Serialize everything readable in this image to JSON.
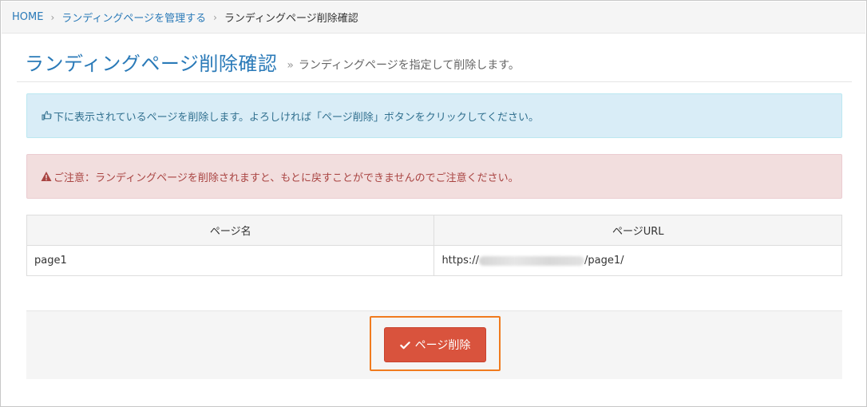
{
  "breadcrumb": {
    "home": "HOME",
    "parent": "ランディングページを管理する",
    "current": "ランディングページ削除確認",
    "separator": "›"
  },
  "header": {
    "title": "ランディングページ削除確認",
    "raquo": "»",
    "subtitle": "ランディングページを指定して削除します。"
  },
  "alerts": {
    "info": "下に表示されているページを削除します。よろしければ「ページ削除」ボタンをクリックしてください。",
    "danger": "ご注意：ランディングページを削除されますと、もとに戻すことができませんのでご注意ください。"
  },
  "table": {
    "headers": [
      "ページ名",
      "ページURL"
    ],
    "rows": [
      {
        "name": "page1",
        "url_prefix": "https://",
        "url_suffix": "/page1/"
      }
    ]
  },
  "actions": {
    "delete_label": "ページ削除"
  },
  "colors": {
    "link": "#2a7ab8",
    "info_bg": "#d9edf7",
    "danger_bg": "#f2dede",
    "button": "#d9533d",
    "highlight": "#f07b1e"
  },
  "icons": {
    "info": "hand-point-right-icon",
    "danger": "warning-icon",
    "button": "check-icon"
  }
}
